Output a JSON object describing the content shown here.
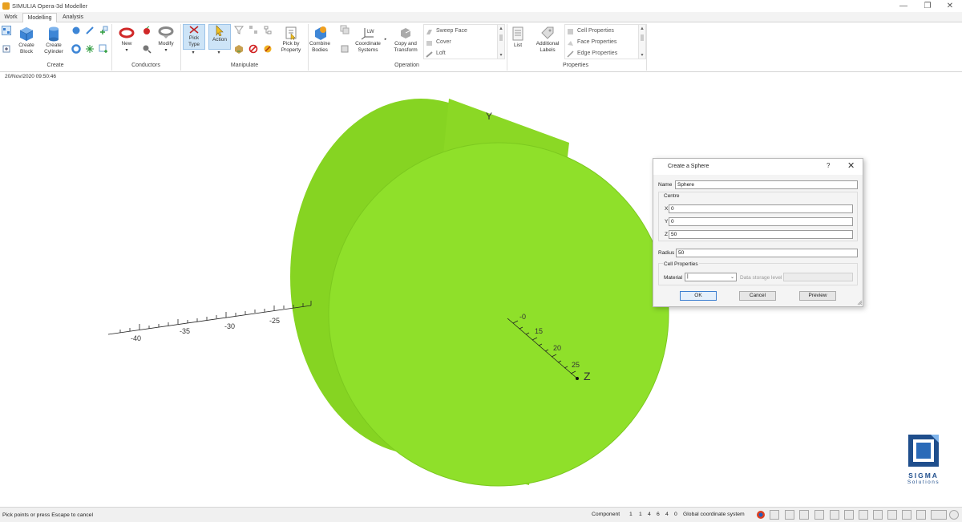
{
  "window": {
    "title": "SIMULIA Opera-3d Modeller",
    "minimize": "—",
    "restore": "❐",
    "close": "✕"
  },
  "tabs": [
    "Work",
    "Modelling",
    "Analysis"
  ],
  "active_tab": "Modelling",
  "ribbon": {
    "groups": {
      "create": "Create",
      "conductors": "Conductors",
      "manipulate": "Manipulate",
      "operation": "Operation",
      "properties": "Properties"
    },
    "create_block": "Create Block",
    "create_block_l1": "Create",
    "create_block_l2": "Block",
    "create_cylinder_l1": "Create",
    "create_cylinder_l2": "Cylinder",
    "new": "New",
    "modify": "Modify",
    "pick_type_l1": "Pick",
    "pick_type_l2": "Type",
    "action": "Action",
    "pick_by_property_l1": "Pick by",
    "pick_by_property_l2": "Property",
    "combine_bodies_l1": "Combine",
    "combine_bodies_l2": "Bodies",
    "coordinate_systems_l1": "Coordinate",
    "coordinate_systems_l2": "Systems",
    "copy_transform_l1": "Copy and",
    "copy_transform_l2": "Transform",
    "operation_gallery": [
      "Sweep Face",
      "Cover",
      "Loft"
    ],
    "list": "List",
    "additional_labels_l1": "Additional",
    "additional_labels_l2": "Labels",
    "properties_gallery": [
      "Cell Properties",
      "Face Properties",
      "Edge Properties"
    ]
  },
  "datetime": "20/Nov/2020 09:50:46",
  "viewport": {
    "axis_y_label": "Y",
    "axis_z_label": "Z",
    "x_ticks": [
      "-40",
      "-35",
      "-30",
      "-25"
    ],
    "z_ticks": [
      "-0",
      "15",
      "20",
      "25"
    ],
    "shape_color": "#8fe02a",
    "shape_dark": "#7cc91f"
  },
  "dialog": {
    "title": "Create a Sphere",
    "help": "?",
    "close": "✕",
    "name_label": "Name",
    "name_value": "Sphere",
    "centre_label": "Centre",
    "x_label": "X",
    "x_value": "0",
    "y_label": "Y",
    "y_value": "0",
    "z_label": "Z",
    "z_value": "50",
    "radius_label": "Radius",
    "radius_value": "50",
    "cell_properties_label": "Cell Properties",
    "material_label": "Material",
    "material_value": "|",
    "data_storage_label": "Data storage level",
    "ok": "OK",
    "cancel": "Cancel",
    "preview": "Preview"
  },
  "logo": {
    "word": "SIGMA",
    "word2": "Solutions"
  },
  "statusbar": {
    "message": "Pick points or press Escape to cancel",
    "component_label": "Component",
    "values": [
      "1",
      "1",
      "4",
      "6",
      "4",
      "0"
    ],
    "coord_system": "Global coordinate system"
  },
  "colors": {
    "accent": "#3c7fd0",
    "highlight": "#cde4f7"
  }
}
